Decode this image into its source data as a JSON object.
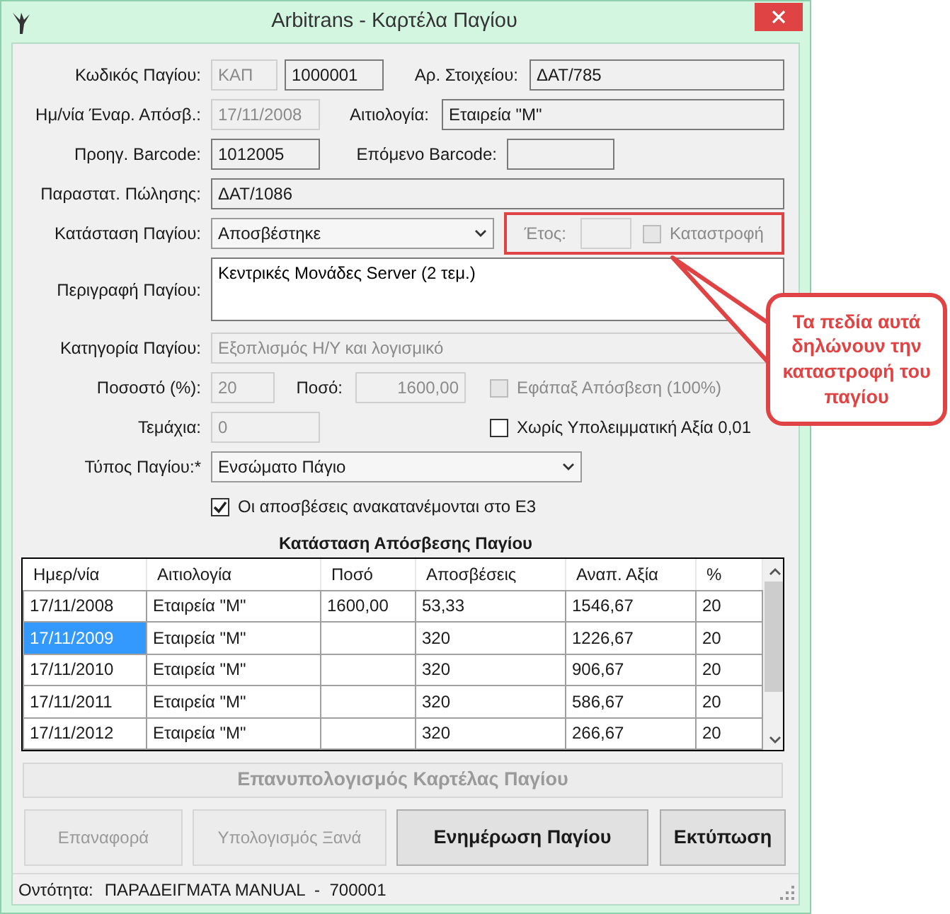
{
  "window": {
    "title": "Arbitrans - Καρτέλα Παγίου"
  },
  "form_rows": [
    {
      "items": [
        {
          "kind": "label",
          "text": "Κωδικός Παγίου:"
        },
        {
          "kind": "field",
          "value": "ΚΑΠ",
          "disabled": true
        },
        {
          "kind": "field",
          "value": "1000001",
          "disabled": false
        },
        {
          "kind": "label",
          "text": "Αρ. Στοιχείου:"
        },
        {
          "kind": "field",
          "value": "ΔΑΤ/785",
          "disabled": false
        }
      ]
    },
    {
      "items": [
        {
          "kind": "label",
          "text": "Ημ/νία Έναρ. Απόσβ.:"
        },
        {
          "kind": "field",
          "value": "17/11/2008",
          "disabled": true
        },
        {
          "kind": "label",
          "text": "Αιτιολογία:"
        },
        {
          "kind": "field",
          "value": "Εταιρεία \"Μ\"",
          "disabled": false
        }
      ]
    },
    {
      "items": [
        {
          "kind": "label",
          "text": "Προηγ. Barcode:"
        },
        {
          "kind": "field",
          "value": "1012005",
          "disabled": false
        },
        {
          "kind": "label",
          "text": "Επόμενο Barcode:"
        },
        {
          "kind": "field",
          "disabled": false
        }
      ]
    },
    {
      "items": [
        {
          "kind": "label",
          "text": "Παραστατ. Πώλησης:"
        },
        {
          "kind": "field",
          "value": "ΔΑΤ/1086",
          "disabled": false
        }
      ]
    },
    {
      "items": [
        {
          "kind": "label",
          "text": "Κατάσταση Παγίου:"
        },
        {
          "kind": "select",
          "value": "Αποσβέστηκε"
        },
        {
          "kind": "group",
          "highlighted": true,
          "items": [
            {
              "kind": "label",
              "text": "Έτος:",
              "disabled": true
            },
            {
              "kind": "field",
              "disabled": true
            },
            {
              "kind": "checkbox",
              "text": "Καταστροφή",
              "checked": false,
              "disabled": true
            }
          ]
        }
      ]
    },
    {
      "items": [
        {
          "kind": "label",
          "text": "Περιγραφή Παγίου:"
        },
        {
          "kind": "textarea",
          "value": "Κεντρικές Μονάδες Server (2 τεμ.)"
        }
      ]
    },
    {
      "items": [
        {
          "kind": "label",
          "text": "Κατηγορία Παγίου:"
        },
        {
          "kind": "field",
          "value": "Εξοπλισμός Η/Υ και λογισμικό",
          "disabled": true
        }
      ]
    },
    {
      "items": [
        {
          "kind": "label",
          "text": "Ποσοστό (%):"
        },
        {
          "kind": "field",
          "value": "20",
          "disabled": true
        },
        {
          "kind": "label",
          "text": "Ποσό:"
        },
        {
          "kind": "field",
          "value": "1600,00",
          "disabled": true
        },
        {
          "kind": "checkbox",
          "text": "Εφάπαξ Απόσβεση (100%)",
          "checked": false,
          "disabled": true
        }
      ]
    },
    {
      "items": [
        {
          "kind": "label",
          "text": "Τεμάχια:"
        },
        {
          "kind": "field",
          "value": "0",
          "disabled": true
        },
        {
          "kind": "checkbox",
          "text": "Χωρίς Υπολειμματική Αξία 0,01",
          "checked": false,
          "disabled": false
        }
      ]
    },
    {
      "items": [
        {
          "kind": "label",
          "text": "Τύπος Παγίου:*"
        },
        {
          "kind": "select",
          "value": "Ενσώματο Πάγιο"
        }
      ]
    },
    {
      "items": [
        {
          "kind": "checkbox",
          "text": "Οι αποσβέσεις ανακατανέμονται στο Ε3",
          "checked": true,
          "disabled": false
        }
      ]
    }
  ],
  "table": {
    "title": "Κατάσταση Απόσβεσης Παγίου",
    "columns": [
      "Ημερ/νία",
      "Αιτιολογία",
      "Ποσό",
      "Αποσβέσεις",
      "Αναπ. Αξία",
      "%"
    ],
    "rows": [
      {
        "selected": false,
        "cells": [
          "17/11/2008",
          "Εταιρεία \"Μ\"",
          "1600,00",
          "53,33",
          "1546,67",
          "20"
        ]
      },
      {
        "selected": true,
        "cells": [
          "17/11/2009",
          "Εταιρεία \"Μ\"",
          "",
          "320",
          "1226,67",
          "20"
        ]
      },
      {
        "selected": false,
        "cells": [
          "17/11/2010",
          "Εταιρεία \"Μ\"",
          "",
          "320",
          "906,67",
          "20"
        ]
      },
      {
        "selected": false,
        "cells": [
          "17/11/2011",
          "Εταιρεία \"Μ\"",
          "",
          "320",
          "586,67",
          "20"
        ]
      },
      {
        "selected": false,
        "cells": [
          "17/11/2012",
          "Εταιρεία \"Μ\"",
          "",
          "320",
          "266,67",
          "20"
        ]
      }
    ]
  },
  "recalc_button": {
    "label": "Επανυπολογισμός Καρτέλας Παγίου",
    "disabled": true,
    "bold": true
  },
  "buttons": [
    {
      "label": "Επαναφορά",
      "disabled": true,
      "bold": false
    },
    {
      "label": "Υπολογισμός Ξανά",
      "disabled": true,
      "bold": false
    },
    {
      "label": "Ενημέρωση Παγίου",
      "disabled": false,
      "bold": true
    },
    {
      "label": "Εκτύπωση",
      "disabled": false,
      "bold": true
    }
  ],
  "status_bar": {
    "label": "Οντότητα:",
    "value": "ΠΑΡΑΔΕΙΓΜΑΤΑ MANUAL  -  700001"
  },
  "callout": {
    "text": "Τα πεδία αυτά δηλώνουν την καταστροφή του παγίου"
  }
}
